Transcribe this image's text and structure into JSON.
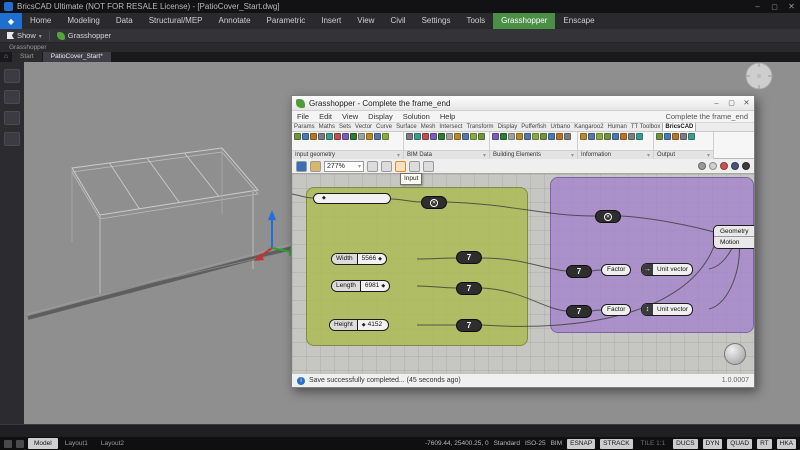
{
  "colors": {
    "accent_green": "#4a8f45",
    "group_green": "#acbb54",
    "group_purple": "#a385cb",
    "viewport_gray": "#8f8f8f"
  },
  "cad": {
    "title": "BricsCAD Ultimate (NOT FOR RESALE License) - [PatioCover_Start.dwg]",
    "ribbon_tabs": [
      "Home",
      "Modeling",
      "Data",
      "Structural/MEP",
      "Annotate",
      "Parametric",
      "Insert",
      "View",
      "Civil",
      "Settings",
      "Tools",
      "Grasshopper",
      "Enscape"
    ],
    "active_ribbon_tab": "Grasshopper",
    "toolbar": {
      "show": "Show",
      "grasshopper": "Grasshopper"
    },
    "panel_caption": "Grasshopper",
    "doc_tabs": [
      {
        "label": "Start",
        "active": false
      },
      {
        "label": "PatioCover_Start*",
        "active": true
      }
    ],
    "model_tabs": [
      {
        "label": "Model",
        "active": true
      },
      {
        "label": "Layout1",
        "active": false
      },
      {
        "label": "Layout2",
        "active": false
      }
    ],
    "status": {
      "coords": "-7609.44, 25400.25, 0",
      "fields": [
        "Standard",
        "ISO-25",
        "BIM"
      ],
      "toggles": [
        {
          "label": "ESNAP",
          "on": true
        },
        {
          "label": "STRACK",
          "on": true
        },
        {
          "label": "TILE 1:1",
          "on": false
        },
        {
          "label": "DUCS",
          "on": true
        },
        {
          "label": "DYN",
          "on": true
        },
        {
          "label": "QUAD",
          "on": true
        },
        {
          "label": "RT",
          "on": true
        },
        {
          "label": "HKA",
          "on": true
        }
      ]
    }
  },
  "grasshopper": {
    "title": "Grasshopper - Complete the frame_end",
    "menus": [
      "File",
      "Edit",
      "View",
      "Display",
      "Solution",
      "Help"
    ],
    "doc_name": "Complete the frame_end",
    "tabs": [
      "Params",
      "Maths",
      "Sets",
      "Vector",
      "Curve",
      "Surface",
      "Mesh",
      "Intersect",
      "Transform",
      "Display",
      "Pufferfish",
      "Urbano",
      "Kangaroo2",
      "Human",
      "TT Toolbox",
      "BricsCAD"
    ],
    "active_tab": "BricsCAD",
    "ribbon_groups": [
      {
        "label": "Input geometry",
        "icons": 12
      },
      {
        "label": "BIM Data",
        "icons": 10
      },
      {
        "label": "Building Elements",
        "icons": 10
      },
      {
        "label": "Information",
        "icons": 8
      },
      {
        "label": "Output",
        "icons": 5
      }
    ],
    "zoom": "277%",
    "tooltip": "Input",
    "status_message": "Save successfully completed... (45 seconds ago)",
    "version": "1.0.0007",
    "canvas": {
      "sliders": [
        {
          "name": "Width",
          "value": "5566"
        },
        {
          "name": "Length",
          "value": "6981"
        },
        {
          "name": "Height",
          "value": "4152"
        }
      ],
      "number_label": "7",
      "multiply_glyph": "✕",
      "vector_rows": [
        {
          "factor": "Factor",
          "component": "Unit vector",
          "icon": "→"
        },
        {
          "factor": "Factor",
          "component": "Unit vector",
          "icon": "↕"
        }
      ],
      "move_inputs": [
        "Geometry",
        "Motion"
      ]
    }
  }
}
